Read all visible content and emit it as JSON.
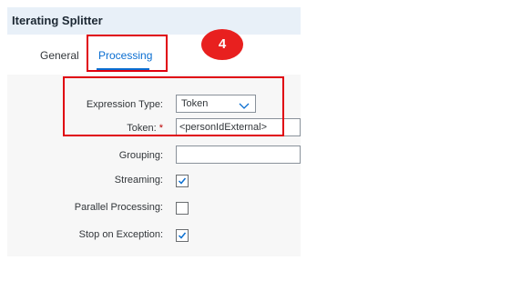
{
  "header": {
    "title": "Iterating Splitter"
  },
  "tabs": [
    {
      "label": "General",
      "active": false
    },
    {
      "label": "Processing",
      "active": true
    }
  ],
  "step_badge": "4",
  "form": {
    "expression_type": {
      "label": "Expression Type:",
      "value": "Token"
    },
    "token": {
      "label": "Token:",
      "required_mark": "*",
      "value": "<personIdExternal>"
    },
    "grouping": {
      "label": "Grouping:",
      "value": ""
    },
    "streaming": {
      "label": "Streaming:",
      "checked": true
    },
    "parallel_processing": {
      "label": "Parallel Processing:",
      "checked": false
    },
    "stop_on_exception": {
      "label": "Stop on Exception:",
      "checked": true
    }
  },
  "colors": {
    "accent": "#0a6ed1",
    "highlight": "#e0000f",
    "badge": "#e8201f",
    "required": "#bb0000"
  },
  "icons": {
    "dropdown": "chevron-down-icon",
    "checkbox": "checkmark-icon"
  }
}
